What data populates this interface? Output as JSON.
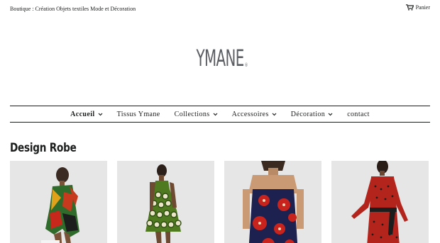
{
  "header": {
    "tagline": "Boutique : Création Objets textiles Mode et Décoration",
    "cart_label": "Panier",
    "cart_icon": "shopping-cart-icon"
  },
  "logo": {
    "text": "YMANE",
    "mark": "®",
    "color": "#5a5d62"
  },
  "nav": {
    "items": [
      {
        "label": "Accueil",
        "dropdown": true,
        "active": true
      },
      {
        "label": "Tissus Ymane",
        "dropdown": false
      },
      {
        "label": "Collections",
        "dropdown": true
      },
      {
        "label": "Accessoires",
        "dropdown": true
      },
      {
        "label": "Décoration",
        "dropdown": true
      },
      {
        "label": "contact",
        "dropdown": false
      }
    ]
  },
  "collection": {
    "title": "Design Robe",
    "products": [
      {
        "image": "model in multicolor geometric print wrap dress"
      },
      {
        "image": "model in green and white circle print sleeveless dress"
      },
      {
        "image": "model in navy slip dress with red floral print"
      },
      {
        "image": "model in red and black long-sleeve wrap dress"
      }
    ]
  }
}
